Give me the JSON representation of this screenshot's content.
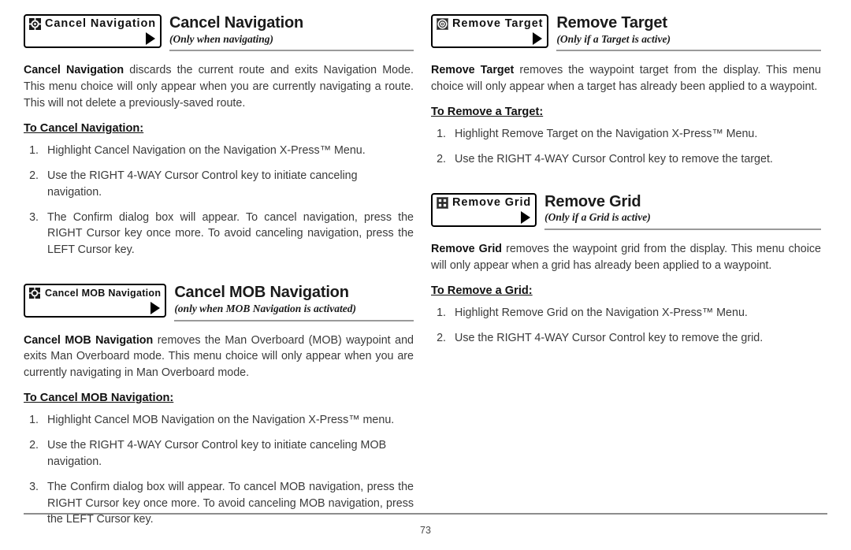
{
  "page": {
    "number": "73"
  },
  "left_column": {
    "sections": [
      {
        "chip": {
          "label": "Cancel Navigation",
          "icon": "cancel-navigation-icon",
          "arrow": "right-triangle-icon"
        },
        "title": "Cancel Navigation",
        "subtitle": "(Only when navigating)",
        "paragraphs": [
          {
            "lead": "Cancel Navigation",
            "rest": " discards the current route and exits Navigation Mode. This menu choice will only appear when you are currently navigating a route. This will not delete a previously-saved route."
          }
        ],
        "sub_head": "To Cancel Navigation:",
        "steps": [
          {
            "num": "1.",
            "text": "Highlight Cancel Navigation on the Navigation X-Press™ Menu."
          },
          {
            "num": "2.",
            "text": "Use the RIGHT 4-WAY Cursor Control key to initiate canceling navigation."
          },
          {
            "num": "3.",
            "text": "The Confirm dialog box will appear. To cancel navigation, press the RIGHT Cursor key once more. To avoid canceling navigation, press the LEFT Cursor key."
          }
        ]
      },
      {
        "chip": {
          "label": "Cancel MOB Navigation",
          "icon": "cancel-mob-navigation-icon",
          "arrow": "right-triangle-icon"
        },
        "title": "Cancel MOB Navigation",
        "subtitle": "(only when MOB Navigation is activated)",
        "paragraphs": [
          {
            "lead": "Cancel MOB Navigation",
            "rest": " removes the Man Overboard (MOB) waypoint and exits Man Overboard mode. This menu choice will only appear when you are currently navigating in Man Overboard mode."
          }
        ],
        "sub_head": "To Cancel MOB Navigation:",
        "steps": [
          {
            "num": "1.",
            "text": "Highlight Cancel MOB Navigation on the Navigation X-Press™ menu."
          },
          {
            "num": "2.",
            "text": "Use the RIGHT 4-WAY Cursor Control key to initiate canceling MOB navigation."
          },
          {
            "num": "3.",
            "text": "The Confirm dialog box will appear. To cancel MOB navigation, press the RIGHT Cursor key once more. To avoid canceling MOB navigation, press the LEFT Cursor key."
          }
        ]
      }
    ]
  },
  "right_column": {
    "sections": [
      {
        "chip": {
          "label": "Remove Target",
          "icon": "target-bullseye-icon",
          "arrow": "right-triangle-icon"
        },
        "title": "Remove Target",
        "subtitle": "(Only if a Target is active)",
        "paragraphs": [
          {
            "lead": "Remove Target",
            "rest": " removes the waypoint target from the display. This menu choice will only appear when a target has already been applied to a waypoint."
          }
        ],
        "sub_head": "To Remove a Target:",
        "steps": [
          {
            "num": "1.",
            "text": "Highlight Remove Target on the Navigation X-Press™ Menu."
          },
          {
            "num": "2.",
            "text": "Use the RIGHT 4-WAY Cursor Control key to remove the target."
          }
        ]
      },
      {
        "chip": {
          "label": "Remove Grid",
          "icon": "grid-icon",
          "arrow": "right-triangle-icon"
        },
        "title": "Remove Grid",
        "subtitle": "(Only if a Grid is active)",
        "paragraphs": [
          {
            "lead": "Remove Grid",
            "rest": " removes the waypoint grid from the display. This menu choice will only appear when a grid has already been applied to a waypoint."
          }
        ],
        "sub_head": "To Remove a Grid:",
        "steps": [
          {
            "num": "1.",
            "text": "Highlight Remove Grid on the Navigation X-Press™ Menu."
          },
          {
            "num": "2.",
            "text": "Use the RIGHT 4-WAY Cursor Control key to remove the grid."
          }
        ]
      }
    ]
  },
  "colors": {
    "text": "#3a3a3a",
    "heading": "#111111",
    "rule": "#9a9a9a",
    "chip_border": "#000000"
  }
}
